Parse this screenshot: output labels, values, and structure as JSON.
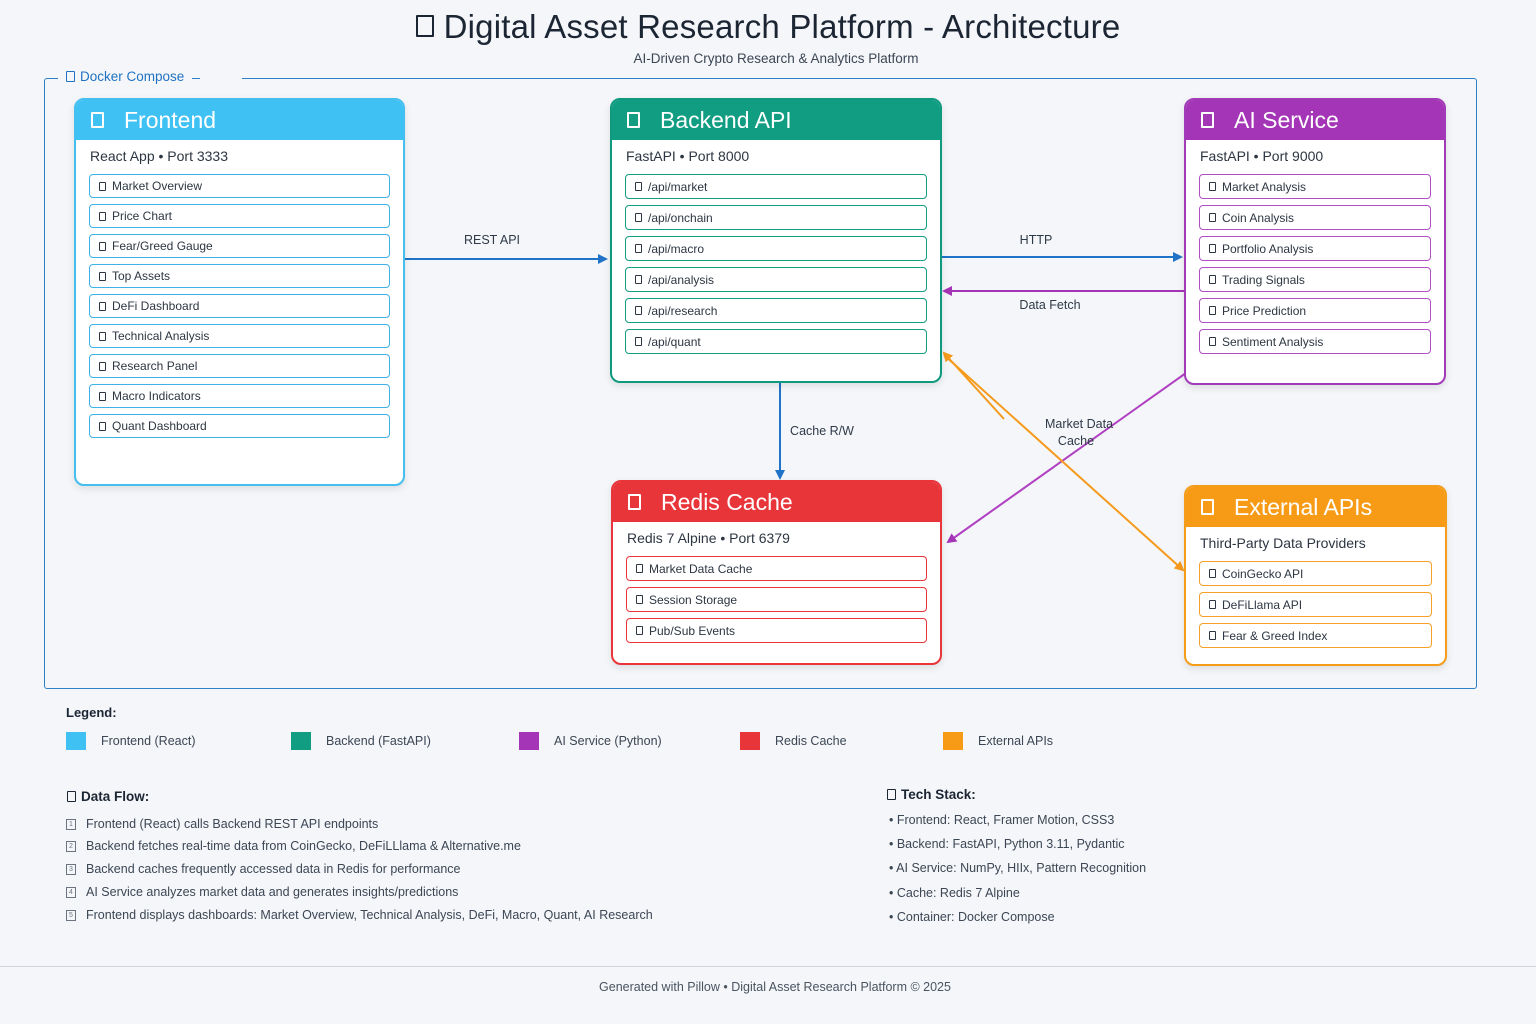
{
  "header": {
    "title": "Digital Asset Research Platform - Architecture",
    "subtitle": "AI-Driven Crypto Research & Analytics Platform"
  },
  "compose": {
    "label": "Docker Compose"
  },
  "services": {
    "frontend": {
      "name": "Frontend",
      "subtitle": "React App • Port 3333",
      "color": "#3fc1f4",
      "items": [
        "Market Overview",
        "Price Chart",
        "Fear/Greed Gauge",
        "Top Assets",
        "DeFi Dashboard",
        "Technical Analysis",
        "Research Panel",
        "Macro Indicators",
        "Quant Dashboard"
      ]
    },
    "backend": {
      "name": "Backend API",
      "subtitle": "FastAPI • Port 8000",
      "color": "#109d82",
      "items": [
        "/api/market",
        "/api/onchain",
        "/api/macro",
        "/api/analysis",
        "/api/research",
        "/api/quant"
      ]
    },
    "ai": {
      "name": "AI Service",
      "subtitle": "FastAPI • Port 9000",
      "color": "#a435b6",
      "items": [
        "Market Analysis",
        "Coin Analysis",
        "Portfolio Analysis",
        "Trading Signals",
        "Price Prediction",
        "Sentiment Analysis"
      ]
    },
    "redis": {
      "name": "Redis Cache",
      "subtitle": "Redis 7 Alpine • Port 6379",
      "color": "#e8353a",
      "items": [
        "Market Data Cache",
        "Session Storage",
        "Pub/Sub Events"
      ]
    },
    "external": {
      "name": "External APIs",
      "subtitle": "Third-Party Data Providers",
      "color": "#f79b17",
      "items": [
        "CoinGecko API",
        "DeFiLlama API",
        "Fear & Greed Index"
      ]
    }
  },
  "connections": {
    "rest_api": "REST API",
    "http": "HTTP",
    "data_fetch": "Data Fetch",
    "cache_rw": "Cache R/W",
    "market_data_cache_1": "Market Data",
    "market_data_cache_2": "Cache"
  },
  "legend": {
    "title": "Legend:",
    "items": [
      {
        "label": "Frontend (React)",
        "color": "#3fc1f4"
      },
      {
        "label": "Backend (FastAPI)",
        "color": "#109d82"
      },
      {
        "label": "AI Service (Python)",
        "color": "#a435b6"
      },
      {
        "label": "Redis Cache",
        "color": "#e8353a"
      },
      {
        "label": "External APIs",
        "color": "#f79b17"
      }
    ]
  },
  "data_flow": {
    "title": "Data Flow:",
    "steps": [
      {
        "num": "1",
        "text": "Frontend (React) calls Backend REST API endpoints"
      },
      {
        "num": "2",
        "text": "Backend fetches real-time data from CoinGecko, DeFiLLlama & Alternative.me"
      },
      {
        "num": "3",
        "text": "Backend caches frequently accessed data in Redis for performance"
      },
      {
        "num": "4",
        "text": "AI Service analyzes market data and generates insights/predictions"
      },
      {
        "num": "5",
        "text": "Frontend displays dashboards: Market Overview, Technical Analysis, DeFi, Macro, Quant, AI Research"
      }
    ]
  },
  "tech_stack": {
    "title": "Tech Stack:",
    "lines": [
      "• Frontend: React, Framer Motion, CSS3",
      "• Backend: FastAPI, Python 3.11, Pydantic",
      "• AI Service: NumPy, HIIx, Pattern Recognition",
      "• Cache: Redis 7 Alpine",
      "• Container: Docker Compose"
    ]
  },
  "footer": {
    "text": "Generated with Pillow • Digital Asset Research Platform © 2025"
  }
}
